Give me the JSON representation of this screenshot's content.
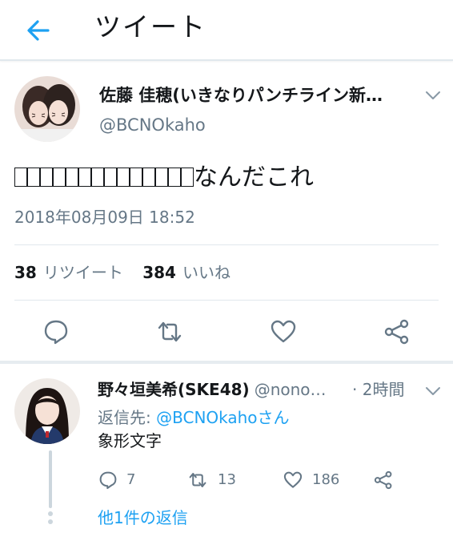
{
  "header": {
    "title": "ツイート"
  },
  "tweet": {
    "author_name": "佐藤 佳穂(いきなりパンチライン新…",
    "author_handle": "@BCNOkaho",
    "text_suffix": "なんだこれ",
    "timestamp": "2018年08月09日 18:52",
    "retweet_count": "38",
    "retweet_label": "リツイート",
    "like_count": "384",
    "like_label": "いいね"
  },
  "reply": {
    "author_name": "野々垣美希(SKE48)",
    "author_handle": "@nono…",
    "time": "· 2時間",
    "reply_to_prefix": "返信先: ",
    "reply_to_mention": "@BCNOkahoさん",
    "text": "象形文字",
    "reply_count": "7",
    "retweet_count": "13",
    "like_count": "186",
    "more_replies": "他1件の返信"
  },
  "colors": {
    "accent": "#1da1f2",
    "secondary_text": "#657786",
    "divider": "#e1e8ed"
  }
}
